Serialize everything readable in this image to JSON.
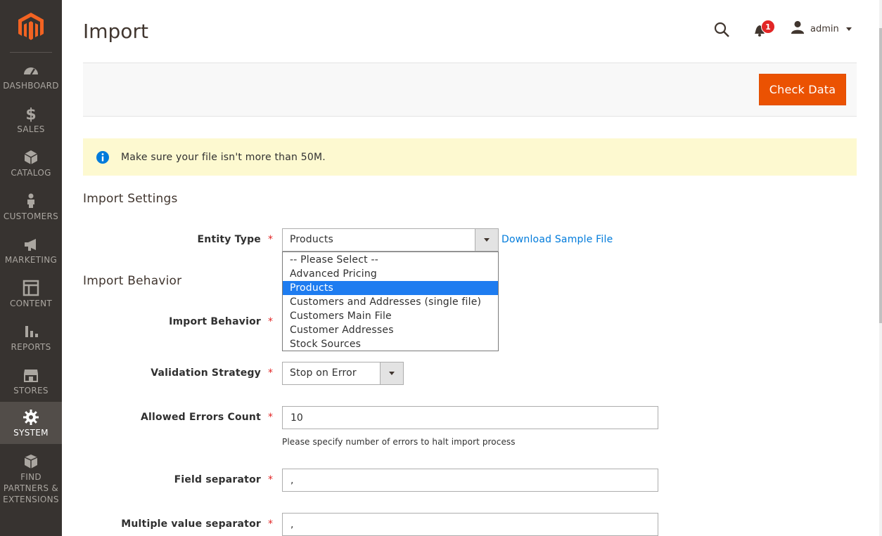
{
  "sidebar": {
    "items": [
      {
        "label": "DASHBOARD",
        "icon": "dashboard-icon"
      },
      {
        "label": "SALES",
        "icon": "dollar-icon"
      },
      {
        "label": "CATALOG",
        "icon": "box-icon"
      },
      {
        "label": "CUSTOMERS",
        "icon": "person-icon"
      },
      {
        "label": "MARKETING",
        "icon": "megaphone-icon"
      },
      {
        "label": "CONTENT",
        "icon": "layout-icon"
      },
      {
        "label": "REPORTS",
        "icon": "bar-chart-icon"
      },
      {
        "label": "STORES",
        "icon": "storefront-icon"
      },
      {
        "label": "SYSTEM",
        "icon": "gear-icon"
      },
      {
        "label_lines": [
          "FIND",
          "PARTNERS &",
          "EXTENSIONS"
        ],
        "icon": "cubes-icon"
      }
    ]
  },
  "header": {
    "title": "Import",
    "notifications_count": "1",
    "username": "admin"
  },
  "actions": {
    "check_data_label": "Check Data"
  },
  "notice": {
    "text": "Make sure your file isn't more than 50M."
  },
  "import_settings": {
    "title": "Import Settings",
    "entity_type": {
      "label": "Entity Type",
      "value": "Products",
      "sample_link": "Download Sample File",
      "options": [
        "-- Please Select --",
        "Advanced Pricing",
        "Products",
        "Customers and Addresses (single file)",
        "Customers Main File",
        "Customer Addresses",
        "Stock Sources"
      ],
      "highlighted_option": "Products"
    }
  },
  "import_behavior": {
    "title": "Import Behavior",
    "behavior_label": "Import Behavior",
    "validation_label": "Validation Strategy",
    "validation_value": "Stop on Error",
    "allowed_errors_label": "Allowed Errors Count",
    "allowed_errors_value": "10",
    "allowed_errors_note": "Please specify number of errors to halt import process",
    "field_separator_label": "Field separator",
    "field_separator_value": ",",
    "multi_separator_label": "Multiple value separator",
    "multi_separator_value": ","
  },
  "colors": {
    "sidebar_bg": "#373330",
    "sidebar_active": "#524d49",
    "primary_button": "#eb5202",
    "notice_bg": "#fdf9d0",
    "link": "#007bdb",
    "selected_option": "#1e7cf0"
  }
}
